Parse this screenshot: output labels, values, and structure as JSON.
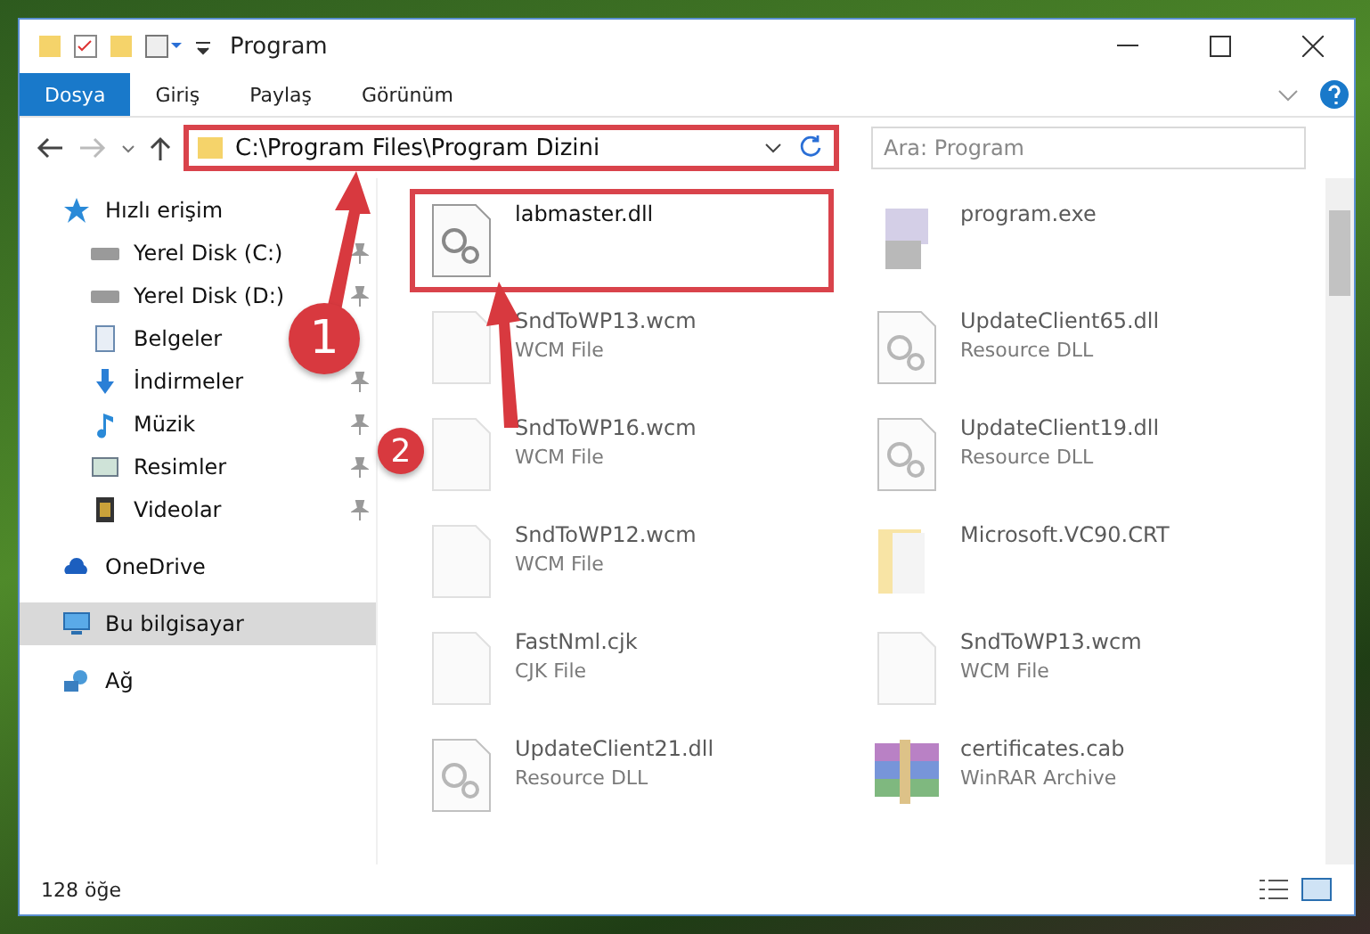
{
  "window": {
    "title": "Program"
  },
  "ribbon_tabs": [
    {
      "label": "Dosya",
      "selected": true
    },
    {
      "label": "Giriş",
      "selected": false
    },
    {
      "label": "Paylaş",
      "selected": false
    },
    {
      "label": "Görünüm",
      "selected": false
    }
  ],
  "address": {
    "value": "C:\\Program Files\\Program Dizini",
    "highlighted": true
  },
  "search": {
    "placeholder": "Ara: Program"
  },
  "sidebar": {
    "items": [
      {
        "label": "Hızlı erişim",
        "kind": "star",
        "selected": false,
        "children": [
          {
            "label": "Yerel Disk (C:)",
            "kind": "drive",
            "pinned": true,
            "selected": false
          },
          {
            "label": "Yerel Disk (D:)",
            "kind": "drive",
            "pinned": true,
            "selected": false
          },
          {
            "label": "Belgeler",
            "kind": "docs",
            "pinned": false,
            "selected": false
          },
          {
            "label": "İndirmeler",
            "kind": "download",
            "pinned": true,
            "selected": false
          },
          {
            "label": "Müzik",
            "kind": "music",
            "pinned": true,
            "selected": false
          },
          {
            "label": "Resimler",
            "kind": "pictures",
            "pinned": true,
            "selected": false
          },
          {
            "label": "Videolar",
            "kind": "video",
            "pinned": true,
            "selected": false
          }
        ]
      },
      {
        "label": "OneDrive",
        "kind": "cloud",
        "selected": false
      },
      {
        "label": "Bu bilgisayar",
        "kind": "pc",
        "selected": true
      },
      {
        "label": "Ağ",
        "kind": "network",
        "selected": false
      }
    ]
  },
  "files": [
    {
      "name": "labmaster.dll",
      "kind": "dll",
      "highlighted": true,
      "blurred": false
    },
    {
      "name": "program.exe",
      "kind": "exe",
      "highlighted": false,
      "blurred": true
    },
    {
      "name": "SndToWP13.wcm",
      "type": "WCM File",
      "kind": "file",
      "highlighted": false,
      "blurred": true
    },
    {
      "name": "UpdateClient65.dll",
      "type": "Resource DLL",
      "kind": "dll",
      "highlighted": false,
      "blurred": true
    },
    {
      "name": "SndToWP16.wcm",
      "type": "WCM File",
      "kind": "file",
      "highlighted": false,
      "blurred": true
    },
    {
      "name": "UpdateClient19.dll",
      "type": "Resource DLL",
      "kind": "dll",
      "highlighted": false,
      "blurred": true
    },
    {
      "name": "SndToWP12.wcm",
      "type": "WCM File",
      "kind": "file",
      "highlighted": false,
      "blurred": true
    },
    {
      "name": "Microsoft.VC90.CRT",
      "kind": "folder",
      "highlighted": false,
      "blurred": true
    },
    {
      "name": "FastNml.cjk",
      "type": "CJK File",
      "kind": "file",
      "highlighted": false,
      "blurred": true
    },
    {
      "name": "SndToWP13.wcm",
      "type": "WCM File",
      "kind": "file",
      "highlighted": false,
      "blurred": true
    },
    {
      "name": "UpdateClient21.dll",
      "type": "Resource DLL",
      "kind": "dll",
      "highlighted": false,
      "blurred": true
    },
    {
      "name": "certificates.cab",
      "type": "WinRAR Archive",
      "kind": "archive",
      "highlighted": false,
      "blurred": true
    }
  ],
  "status_bar": {
    "count": "128 öğe"
  },
  "annotations": [
    {
      "number": "1"
    },
    {
      "number": "2"
    }
  ]
}
